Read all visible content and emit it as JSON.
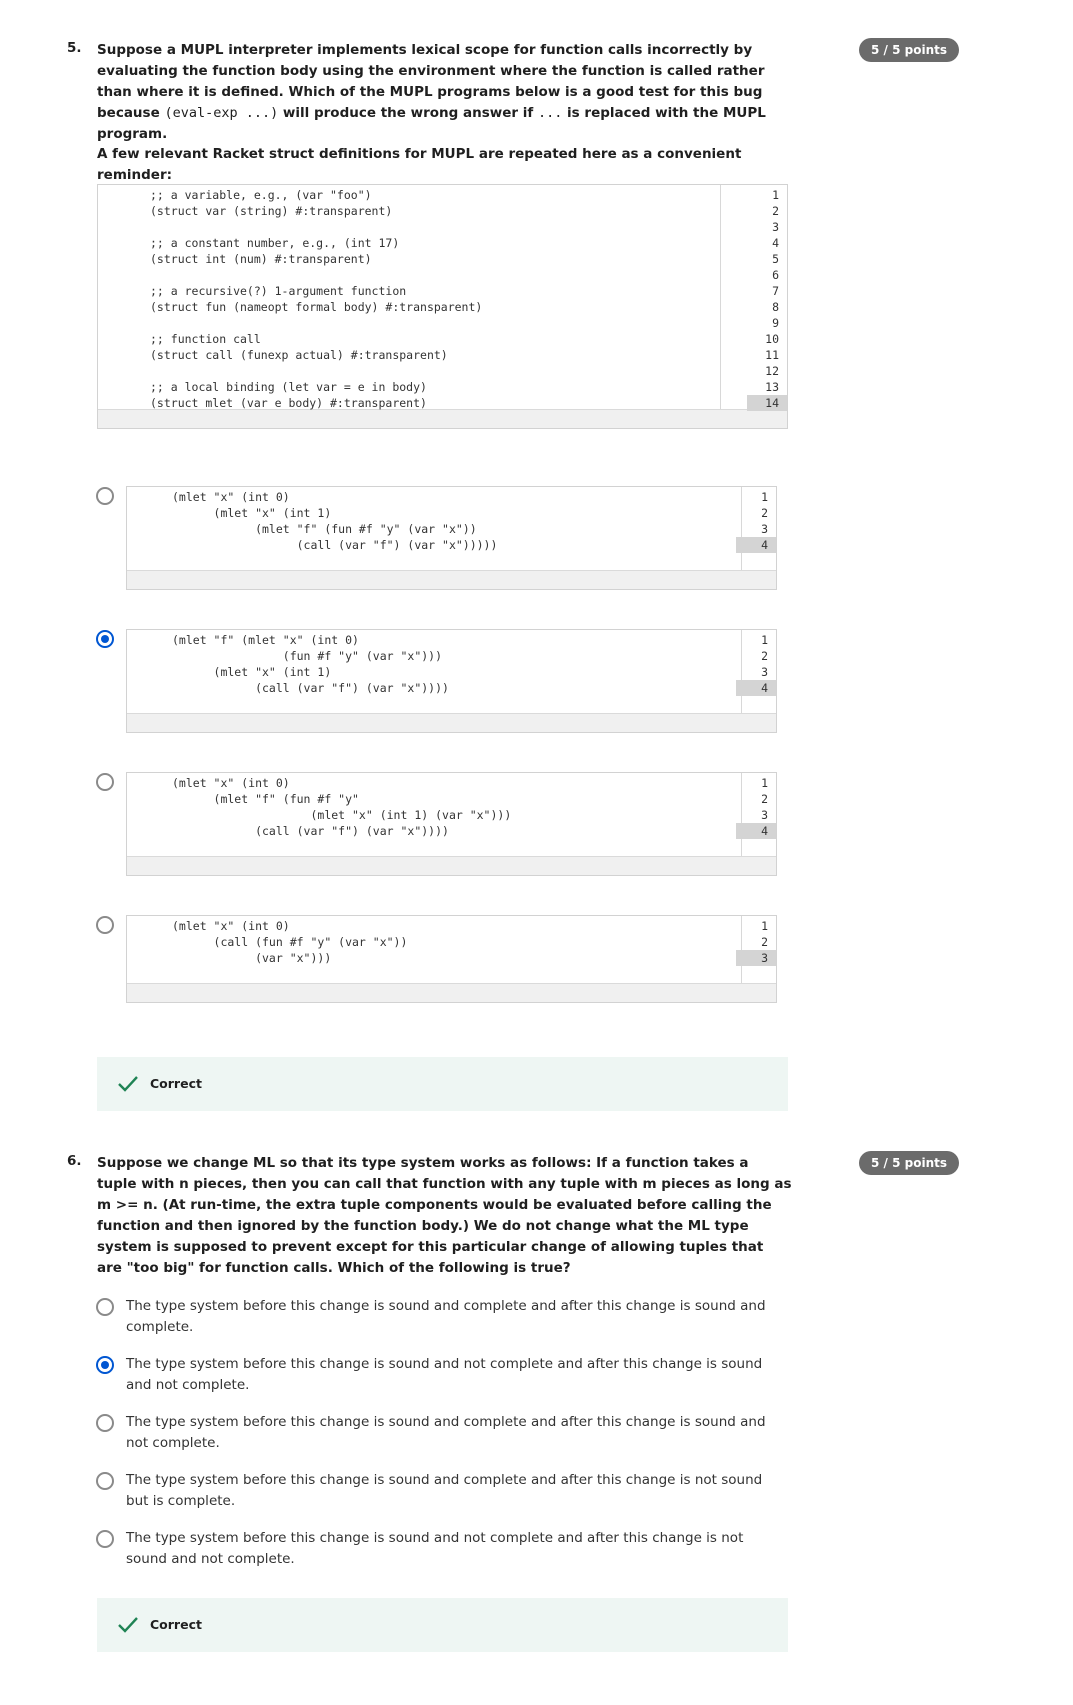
{
  "q5": {
    "number": "5.",
    "text_a": "Suppose a MUPL interpreter implements lexical scope for function calls incorrectly by evaluating the function body using the environment where the function is called rather than where it is defined. Which of the MUPL programs below is a good test for this bug because ",
    "code_inline_1": "(eval-exp ...)",
    "text_b": " will produce the wrong answer if ",
    "code_inline_2": "...",
    "text_c": " is replaced with the MUPL program.",
    "points": "5 / 5 points",
    "reminder": "A few relevant Racket struct definitions for MUPL are repeated here as a convenient reminder:",
    "struct_code": [
      ";; a variable, e.g., (var \"foo\")",
      "(struct var (string) #:transparent)",
      "",
      ";; a constant number, e.g., (int 17)",
      "(struct int (num) #:transparent)",
      "",
      ";; a recursive(?) 1-argument function",
      "(struct fun (nameopt formal body) #:transparent)",
      "",
      ";; function call",
      "(struct call (funexp actual) #:transparent)",
      "",
      ";; a local binding (let var = e in body)",
      "(struct mlet (var e body) #:transparent)"
    ],
    "options": [
      {
        "selected": false,
        "code": [
          "(mlet \"x\" (int 0)",
          "      (mlet \"x\" (int 1)",
          "            (mlet \"f\" (fun #f \"y\" (var \"x\"))",
          "                  (call (var \"f\") (var \"x\")))))"
        ]
      },
      {
        "selected": true,
        "code": [
          "(mlet \"f\" (mlet \"x\" (int 0)",
          "                (fun #f \"y\" (var \"x\")))",
          "      (mlet \"x\" (int 1)",
          "            (call (var \"f\") (var \"x\"))))"
        ]
      },
      {
        "selected": false,
        "code": [
          "(mlet \"x\" (int 0)",
          "      (mlet \"f\" (fun #f \"y\"",
          "                    (mlet \"x\" (int 1) (var \"x\")))",
          "            (call (var \"f\") (var \"x\"))))"
        ]
      },
      {
        "selected": false,
        "code": [
          "(mlet \"x\" (int 0)",
          "      (call (fun #f \"y\" (var \"x\"))",
          "            (var \"x\")))"
        ]
      }
    ],
    "feedback": "Correct"
  },
  "q6": {
    "number": "6.",
    "text": "Suppose we change ML so that its type system works as follows: If a function takes a tuple with n pieces, then you can call that function with any tuple with m pieces as long as m >= n. (At run-time, the extra tuple components would be evaluated before calling the function and then ignored by the function body.) We do not change what the ML type system is supposed to prevent except for this particular change of allowing tuples that are \"too big\" for function calls. Which of the following is true?",
    "points": "5 / 5 points",
    "options": [
      {
        "selected": false,
        "label": "The type system before this change is sound and complete and after this change is sound and complete."
      },
      {
        "selected": true,
        "label": "The type system before this change is sound and not complete and after this change is sound and not complete."
      },
      {
        "selected": false,
        "label": "The type system before this change is sound and complete and after this change is sound and not complete."
      },
      {
        "selected": false,
        "label": "The type system before this change is sound and complete and after this change is not sound but is complete."
      },
      {
        "selected": false,
        "label": "The type system before this change is sound and not complete and after this change is not sound and not complete."
      }
    ],
    "feedback": "Correct"
  },
  "colors": {
    "accent": "#0056d2",
    "correct_bg": "#eef6f3",
    "check": "#1f8354",
    "badge": "#6b6b6b"
  }
}
